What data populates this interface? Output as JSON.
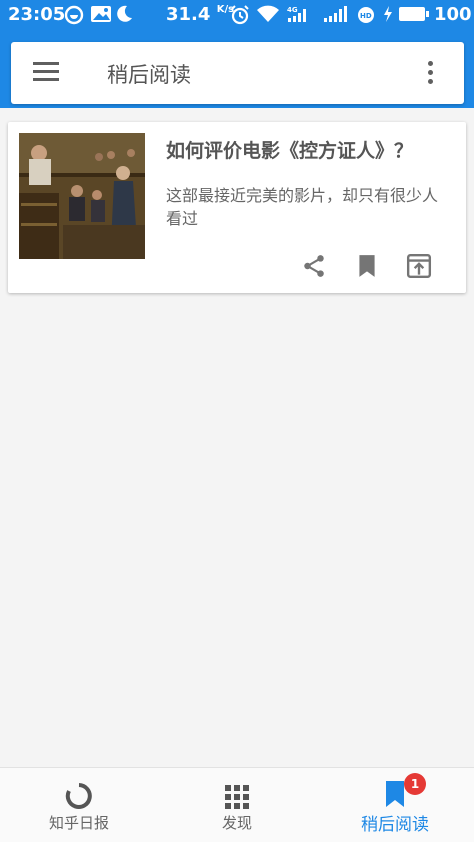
{
  "status_bar": {
    "time": "23:05",
    "speed_value": "31.4",
    "speed_unit": "K/s",
    "battery": "100",
    "icons": [
      "moon-icon",
      "gallery-icon",
      "night-icon",
      "alarm-icon",
      "wifi-icon",
      "signal-4g-icon",
      "signal-icon",
      "hd-icon",
      "charging-icon",
      "battery-icon"
    ]
  },
  "app_bar": {
    "title": "稍后阅读",
    "menu_icon": "hamburger-icon",
    "more_icon": "more-vert-icon"
  },
  "article": {
    "title": "如何评价电影《控方证人》？",
    "summary": "这部最接近完美的影片，却只有很少人看过",
    "actions": [
      "share-icon",
      "bookmark-icon",
      "open-icon"
    ]
  },
  "bottom_nav": {
    "items": [
      {
        "label": "知乎日报",
        "icon": "loading-ring-icon"
      },
      {
        "label": "发现",
        "icon": "grid-icon"
      },
      {
        "label": "稍后阅读",
        "icon": "bookmark-icon"
      }
    ],
    "badge": "1"
  },
  "colors": {
    "primary": "#1e88e5",
    "badge": "#e53935",
    "background": "#f4f4f4"
  }
}
